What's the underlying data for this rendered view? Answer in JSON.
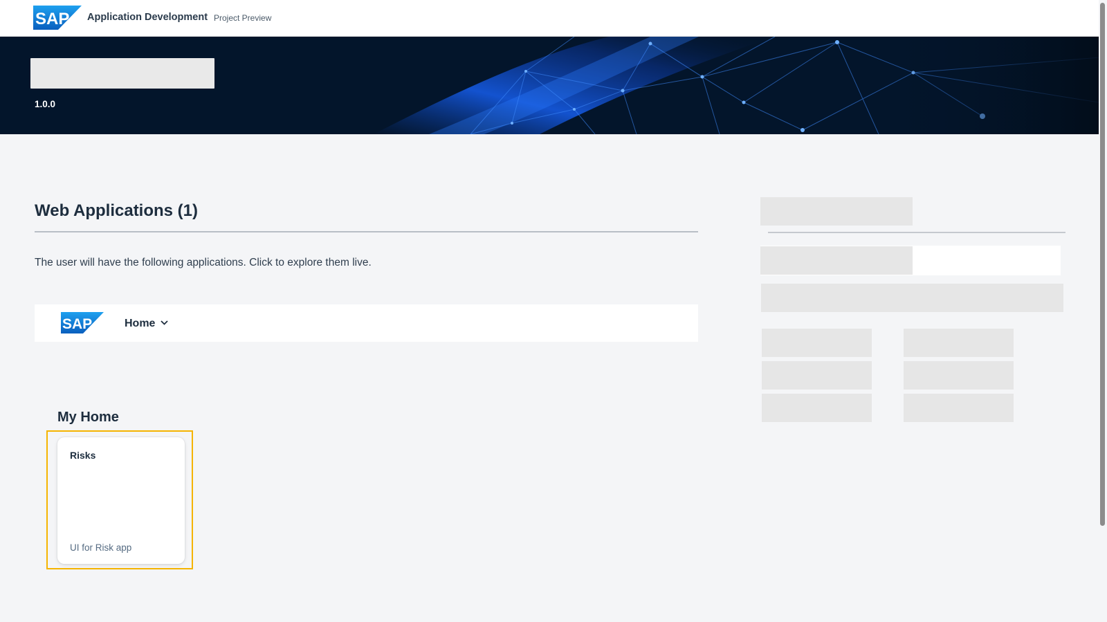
{
  "shell": {
    "logo_text": "SAP",
    "title": "Application Development",
    "subtitle": "Project Preview"
  },
  "hero": {
    "version": "1.0.0"
  },
  "main": {
    "section_title": "Web Applications (1)",
    "description": "The user will have the following applications. Click to explore them live.",
    "preview": {
      "logo_text": "SAP",
      "menu_label": "Home",
      "menu_icon": "chevron-down-icon"
    },
    "group_title": "My Home",
    "tile": {
      "title": "Risks",
      "subtitle": "UI for Risk app"
    }
  },
  "colors": {
    "brand_blue": "#0a6ed1",
    "focus_highlight": "#f5b400",
    "hero_background": "#03152b",
    "page_background": "#f4f5f7",
    "placeholder": "#e6e6e6"
  }
}
